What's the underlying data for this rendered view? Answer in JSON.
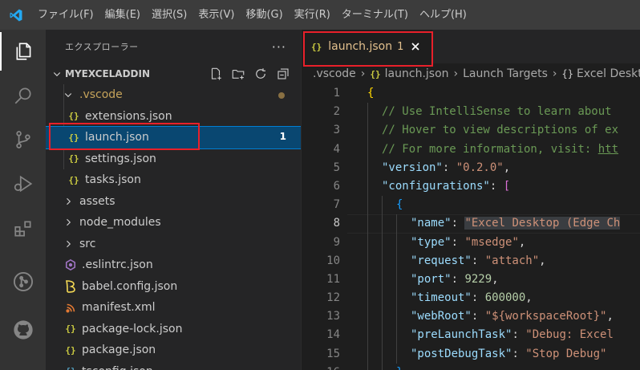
{
  "menu": [
    "ファイル(F)",
    "編集(E)",
    "選択(S)",
    "表示(V)",
    "移動(G)",
    "実行(R)",
    "ターミナル(T)",
    "ヘルプ(H)"
  ],
  "activity": [
    "explorer-icon",
    "search-icon",
    "source-control-icon",
    "run-debug-icon",
    "extensions-icon",
    "git-graph-icon",
    "github-icon"
  ],
  "sidebar": {
    "title": "エクスプローラー",
    "more": "···",
    "project": "MYEXCELADDIN",
    "tools": [
      "new-file-icon",
      "new-folder-icon",
      "refresh-icon",
      "collapse-all-icon"
    ],
    "tree": [
      {
        "label": ".vscode",
        "kind": "folder-open",
        "depth": 1,
        "badge": "dot"
      },
      {
        "label": "extensions.json",
        "kind": "json",
        "depth": 2
      },
      {
        "label": "launch.json",
        "kind": "json",
        "depth": 2,
        "selected": true,
        "count": "1"
      },
      {
        "label": "settings.json",
        "kind": "json",
        "depth": 2
      },
      {
        "label": "tasks.json",
        "kind": "json",
        "depth": 2
      },
      {
        "label": "assets",
        "kind": "folder",
        "depth": 1
      },
      {
        "label": "node_modules",
        "kind": "folder",
        "depth": 1
      },
      {
        "label": "src",
        "kind": "folder",
        "depth": 1
      },
      {
        "label": ".eslintrc.json",
        "kind": "eslint",
        "depth": 1
      },
      {
        "label": "babel.config.json",
        "kind": "babel",
        "depth": 1
      },
      {
        "label": "manifest.xml",
        "kind": "xml",
        "depth": 1
      },
      {
        "label": "package-lock.json",
        "kind": "json",
        "depth": 1
      },
      {
        "label": "package.json",
        "kind": "json",
        "depth": 1
      },
      {
        "label": "tsconfig.json",
        "kind": "ts",
        "depth": 1
      }
    ]
  },
  "tab": {
    "icon": "{}",
    "title": "launch.json",
    "count": "1"
  },
  "breadcrumb": [
    ".vscode",
    "launch.json",
    "Launch Targets",
    "Excel Deskto"
  ],
  "code": {
    "current_line": 8,
    "lines": [
      {
        "n": "1",
        "indent": 0,
        "tokens": [
          {
            "t": "{",
            "c": "c-brace"
          }
        ]
      },
      {
        "n": "2",
        "indent": 1,
        "tokens": [
          {
            "t": "// Use IntelliSense to learn about ",
            "c": "c-comment"
          }
        ]
      },
      {
        "n": "3",
        "indent": 1,
        "tokens": [
          {
            "t": "// Hover to view descriptions of ex",
            "c": "c-comment"
          }
        ]
      },
      {
        "n": "4",
        "indent": 1,
        "tokens": [
          {
            "t": "// For more information, visit: ",
            "c": "c-comment"
          },
          {
            "t": "htt",
            "c": "c-comment c-link"
          }
        ]
      },
      {
        "n": "5",
        "indent": 1,
        "tokens": [
          {
            "t": "\"version\"",
            "c": "c-key"
          },
          {
            "t": ": ",
            "c": "c-punc"
          },
          {
            "t": "\"0.2.0\"",
            "c": "c-str"
          },
          {
            "t": ",",
            "c": "c-punc"
          }
        ]
      },
      {
        "n": "6",
        "indent": 1,
        "tokens": [
          {
            "t": "\"configurations\"",
            "c": "c-key"
          },
          {
            "t": ": ",
            "c": "c-punc"
          },
          {
            "t": "[",
            "c": "c-brace2"
          }
        ]
      },
      {
        "n": "7",
        "indent": 2,
        "tokens": [
          {
            "t": "{",
            "c": "c-brace3"
          }
        ]
      },
      {
        "n": "8",
        "indent": 3,
        "tokens": [
          {
            "t": "\"name\"",
            "c": "c-key"
          },
          {
            "t": ": ",
            "c": "c-punc"
          },
          {
            "t": "\"Excel Desktop (Edge Ch",
            "c": "c-str highlight-word"
          }
        ]
      },
      {
        "n": "9",
        "indent": 3,
        "tokens": [
          {
            "t": "\"type\"",
            "c": "c-key"
          },
          {
            "t": ": ",
            "c": "c-punc"
          },
          {
            "t": "\"msedge\"",
            "c": "c-str"
          },
          {
            "t": ",",
            "c": "c-punc"
          }
        ]
      },
      {
        "n": "10",
        "indent": 3,
        "tokens": [
          {
            "t": "\"request\"",
            "c": "c-key"
          },
          {
            "t": ": ",
            "c": "c-punc"
          },
          {
            "t": "\"attach\"",
            "c": "c-str"
          },
          {
            "t": ",",
            "c": "c-punc"
          }
        ]
      },
      {
        "n": "11",
        "indent": 3,
        "tokens": [
          {
            "t": "\"port\"",
            "c": "c-key"
          },
          {
            "t": ": ",
            "c": "c-punc"
          },
          {
            "t": "9229",
            "c": "c-num"
          },
          {
            "t": ",",
            "c": "c-punc"
          }
        ]
      },
      {
        "n": "12",
        "indent": 3,
        "tokens": [
          {
            "t": "\"timeout\"",
            "c": "c-key"
          },
          {
            "t": ": ",
            "c": "c-punc"
          },
          {
            "t": "600000",
            "c": "c-num"
          },
          {
            "t": ",",
            "c": "c-punc"
          }
        ]
      },
      {
        "n": "13",
        "indent": 3,
        "tokens": [
          {
            "t": "\"webRoot\"",
            "c": "c-key"
          },
          {
            "t": ": ",
            "c": "c-punc"
          },
          {
            "t": "\"${workspaceRoot}\"",
            "c": "c-str"
          },
          {
            "t": ",",
            "c": "c-punc"
          }
        ]
      },
      {
        "n": "14",
        "indent": 3,
        "tokens": [
          {
            "t": "\"preLaunchTask\"",
            "c": "c-key"
          },
          {
            "t": ": ",
            "c": "c-punc"
          },
          {
            "t": "\"Debug: Excel",
            "c": "c-str"
          }
        ]
      },
      {
        "n": "15",
        "indent": 3,
        "tokens": [
          {
            "t": "\"postDebugTask\"",
            "c": "c-key"
          },
          {
            "t": ": ",
            "c": "c-punc"
          },
          {
            "t": "\"Stop Debug\"",
            "c": "c-str"
          }
        ]
      },
      {
        "n": "16",
        "indent": 2,
        "tokens": [
          {
            "t": "},",
            "c": "c-brace3"
          }
        ]
      }
    ]
  },
  "colors": {
    "accent": "#007fd4",
    "selection": "#094771",
    "annotation": "#e8202a",
    "json_icon": "#cbcb41"
  }
}
